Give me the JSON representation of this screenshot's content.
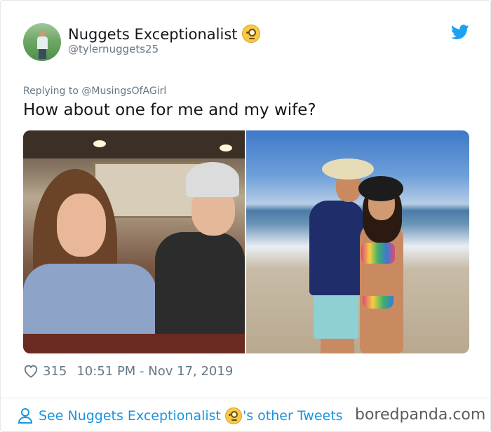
{
  "user": {
    "display_name": "Nuggets Exceptionalist",
    "handle": "@tylernuggets25",
    "emoji": "monocle-face-emoji"
  },
  "tweet": {
    "replying_prefix": "Replying to ",
    "replying_to": "@MusingsOfAGirl",
    "text": "How about one for me and my wife?",
    "photos": [
      {
        "name": "restaurant-photo"
      },
      {
        "name": "beach-photo"
      }
    ]
  },
  "stats": {
    "likes": "315",
    "timestamp": "10:51 PM - Nov 17, 2019"
  },
  "footer": {
    "see_prefix": "See Nuggets Exceptionalist ",
    "see_suffix": "'s other Tweets"
  },
  "watermark": "boredpanda.com",
  "colors": {
    "link": "#1b95e0",
    "twitter_blue": "#1da1f2",
    "secondary_text": "#657786",
    "border": "#e1e8ed"
  },
  "icons": [
    "twitter-bird-icon",
    "heart-icon",
    "person-icon"
  ]
}
